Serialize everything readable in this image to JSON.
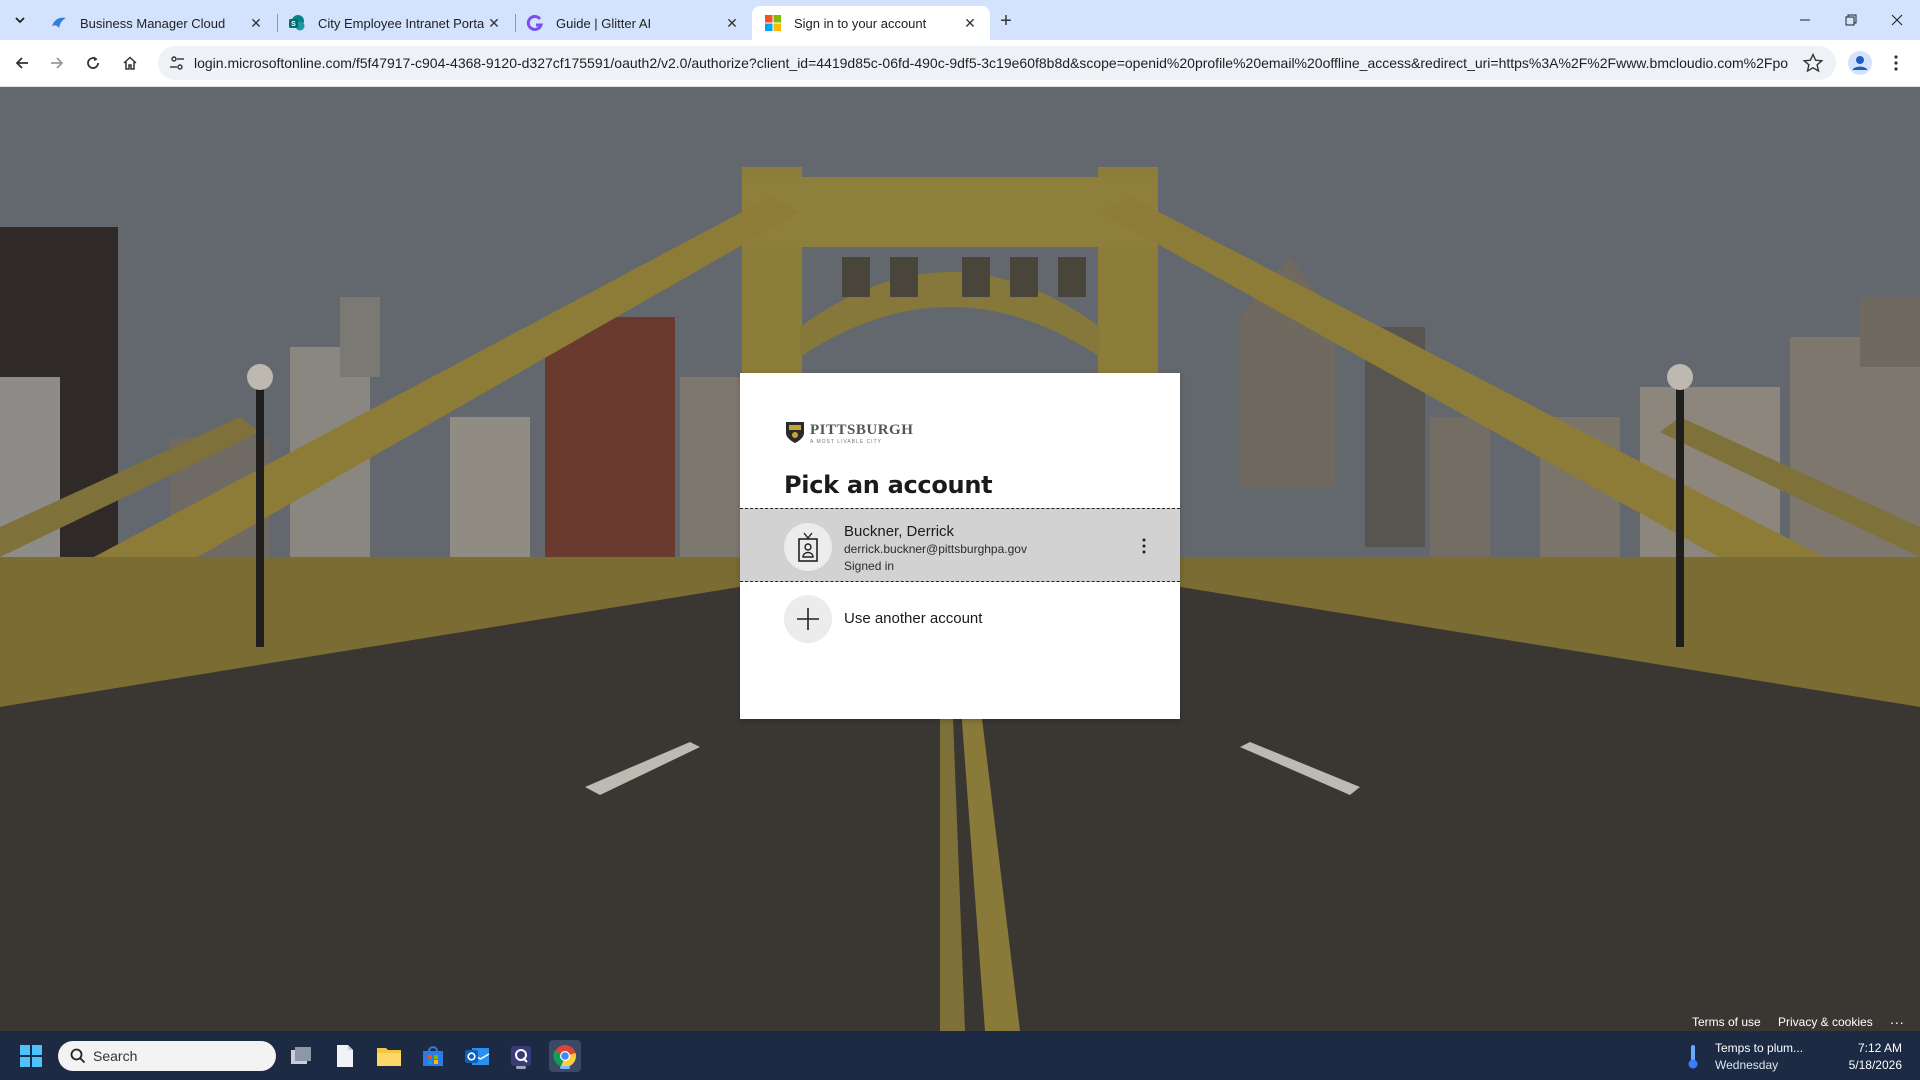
{
  "browser": {
    "tabs": [
      {
        "title": "Business Manager Cloud",
        "favicon": "bmc-bird-icon",
        "active": false
      },
      {
        "title": "City Employee Intranet Portal -",
        "favicon": "sharepoint-icon",
        "active": false
      },
      {
        "title": "Guide | Glitter AI",
        "favicon": "glitter-g-icon",
        "active": false
      },
      {
        "title": "Sign in to your account",
        "favicon": "microsoft-logo-icon",
        "active": true
      }
    ],
    "url": "login.microsoftonline.com/f5f47917-c904-4368-9120-d327cf175591/oauth2/v2.0/authorize?client_id=4419d85c-06fd-490c-9df5-3c19e60f8b8d&scope=openid%20profile%20email%20offline_access&redirect_uri=https%3A%2F%2Fwww.bmcloudio.com%2Fpo...",
    "accent_color": "#d3e3fd"
  },
  "signin": {
    "logo": {
      "text": "PITTSBURGH",
      "subtext": "A MOST LIVABLE CITY"
    },
    "heading": "Pick an account",
    "accounts": [
      {
        "name": "Buckner, Derrick",
        "email": "derrick.buckner@pittsburghpa.gov",
        "status": "Signed in"
      }
    ],
    "use_another": "Use another account",
    "footer": {
      "terms": "Terms of use",
      "privacy": "Privacy & cookies",
      "more": "..."
    }
  },
  "taskbar": {
    "search_placeholder": "Search",
    "weather": {
      "title": "Temps to plum...",
      "subtitle": "Wednesday"
    },
    "clock": {
      "time": "7:12 AM",
      "date": "5/18/2026"
    },
    "background_color": "#1c2a44"
  }
}
